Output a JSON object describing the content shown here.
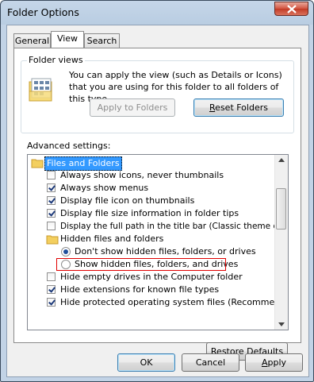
{
  "window": {
    "title": "Folder Options"
  },
  "tabs": [
    {
      "label": "General",
      "active": false
    },
    {
      "label": "View",
      "active": true
    },
    {
      "label": "Search",
      "active": false
    }
  ],
  "folder_views": {
    "title": "Folder views",
    "description": "You can apply the view (such as Details or Icons) that you are using for this folder to all folders of this type.",
    "apply_button": "Apply to Folders",
    "reset_button_prefix": "",
    "reset_button_mnemonic": "R",
    "reset_button_rest": "eset Folders"
  },
  "advanced": {
    "label": "Advanced settings:",
    "items": [
      {
        "kind": "folder",
        "label": "Files and Folders",
        "selected": true
      },
      {
        "kind": "checkbox",
        "label": "Always show icons, never thumbnails",
        "checked": false
      },
      {
        "kind": "checkbox",
        "label": "Always show menus",
        "checked": true
      },
      {
        "kind": "checkbox",
        "label": "Display file icon on thumbnails",
        "checked": true
      },
      {
        "kind": "checkbox",
        "label": "Display file size information in folder tips",
        "checked": true
      },
      {
        "kind": "checkbox",
        "label": "Display the full path in the title bar (Classic theme only)",
        "checked": false
      },
      {
        "kind": "folder",
        "label": "Hidden files and folders"
      },
      {
        "kind": "radio",
        "label": "Don't show hidden files, folders, or drives",
        "checked": true
      },
      {
        "kind": "radio",
        "label": "Show hidden files, folders, and drives",
        "checked": false
      },
      {
        "kind": "checkbox",
        "label": "Hide empty drives in the Computer folder",
        "checked": false
      },
      {
        "kind": "checkbox",
        "label": "Hide extensions for known file types",
        "checked": true
      },
      {
        "kind": "checkbox",
        "label": "Hide protected operating system files (Recommended)",
        "checked": true
      }
    ]
  },
  "buttons": {
    "restore_prefix": "Restore ",
    "restore_mnemonic": "D",
    "restore_rest": "efaults",
    "ok": "OK",
    "cancel": "Cancel",
    "apply_mnemonic": "A",
    "apply_rest": "pply"
  },
  "colors": {
    "selection": "#3399ff",
    "highlight_border": "#e00000"
  }
}
